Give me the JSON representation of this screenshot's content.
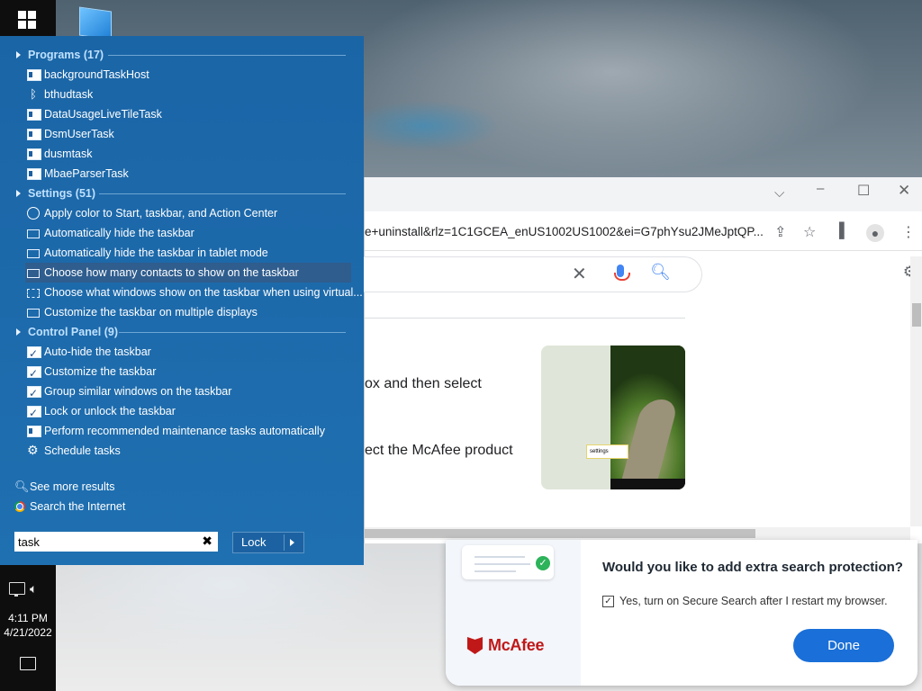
{
  "start_menu": {
    "groups": [
      {
        "title": "Programs (17)",
        "items": [
          "backgroundTaskHost",
          "bthudtask",
          "DataUsageLiveTileTask",
          "DsmUserTask",
          "dusmtask",
          "MbaeParserTask"
        ]
      },
      {
        "title": "Settings (51)",
        "items": [
          "Apply color to Start, taskbar, and Action Center",
          "Automatically hide the taskbar",
          "Automatically hide the taskbar in tablet mode",
          "Choose how many contacts to show on the taskbar",
          "Choose what windows show on the taskbar when using virtual...",
          "Customize the taskbar on multiple displays"
        ]
      },
      {
        "title": "Control Panel (9)",
        "items": [
          "Auto-hide the taskbar",
          "Customize the taskbar",
          "Group similar windows on the taskbar",
          "Lock or unlock the taskbar",
          "Perform recommended maintenance tasks automatically",
          "Schedule tasks"
        ]
      }
    ],
    "selected_item": "Choose how many contacts to show on the taskbar",
    "footer": {
      "see_more": "See more results",
      "search_internet": "Search the Internet"
    },
    "search": {
      "value": "task"
    },
    "power_button": {
      "label": "Lock"
    }
  },
  "taskbar": {
    "time": "4:11 PM",
    "date": "4/21/2022"
  },
  "browser": {
    "url": "e+uninstall&rlz=1C1GCEA_enUS1002US1002&ei=G7phYsu2JMeJptQP...",
    "content": {
      "line1": "ox and then select",
      "line2": "ect the McAfee product",
      "thumb_callout": "settings"
    }
  },
  "mcafee_popup": {
    "question": "Would you like to add extra search protection?",
    "checkbox_label": "Yes, turn on Secure Search after I restart my browser.",
    "checkbox_checked": true,
    "done_label": "Done",
    "brand": "McAfee"
  },
  "colors": {
    "start_menu_bg": "#1d6aab",
    "selected_row": "#2f5d8e",
    "mcafee_red": "#c01818",
    "done_button": "#1a6fd8"
  }
}
